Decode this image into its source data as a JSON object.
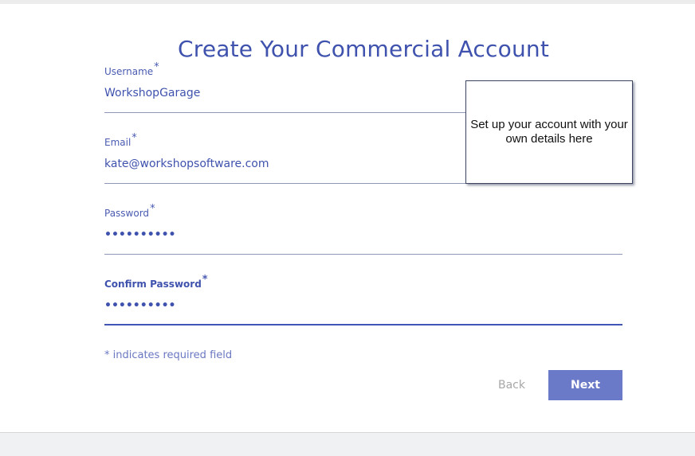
{
  "page": {
    "title": "Create Your Commercial Account"
  },
  "form": {
    "username": {
      "label": "Username",
      "required_marker": "*",
      "value": "WorkshopGarage"
    },
    "email": {
      "label": "Email",
      "required_marker": "*",
      "value": "kate@workshopsoftware.com"
    },
    "password": {
      "label": "Password",
      "required_marker": "*",
      "value": "••••••••••"
    },
    "confirm_password": {
      "label": "Confirm Password",
      "required_marker": "*",
      "value": "••••••••••"
    },
    "required_note": "* indicates required field"
  },
  "buttons": {
    "back_label": "Back",
    "next_label": "Next"
  },
  "callout": {
    "text": "Set up your account with your own details here"
  },
  "colors": {
    "accent": "#3f52ad",
    "button_primary": "#6b7ac8",
    "disabled_text": "#a7a7a7"
  }
}
